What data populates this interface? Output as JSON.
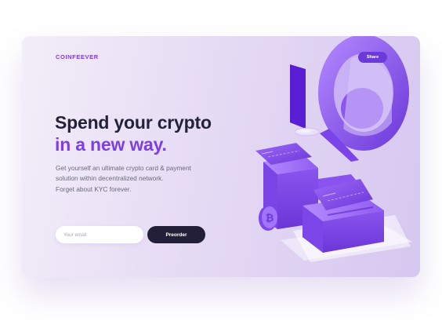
{
  "brand": {
    "name": "COINFEEVER"
  },
  "header": {
    "share_label": "Share"
  },
  "hero": {
    "headline_line1": "Spend your crypto",
    "headline_line2": "in a new way.",
    "description_lines": [
      "Get yourself an ultimate crypto card & payment",
      "solution within decentralized network.",
      "Forget about KYC forever."
    ]
  },
  "form": {
    "email_placeholder": "Your email",
    "email_value": "",
    "preorder_label": "Preorder"
  },
  "colors": {
    "accent": "#7b3fe4",
    "dark": "#241f38",
    "background_start": "#f3eef9",
    "background_end": "#d6c7f0"
  },
  "icons": [
    "bitcoin-coin-icon"
  ]
}
